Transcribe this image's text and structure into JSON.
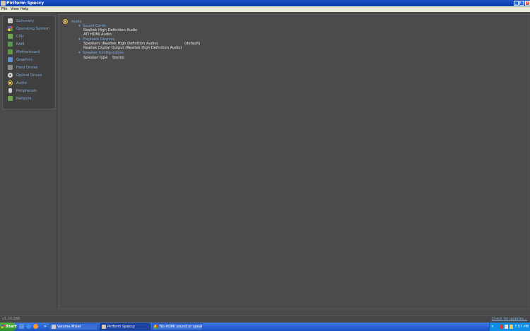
{
  "window": {
    "title": "Piriform Speccy",
    "controls": {
      "minimize": "_",
      "maximize": "□",
      "close": "×"
    }
  },
  "menu": [
    "File",
    "View",
    "Help"
  ],
  "sidebar": {
    "items": [
      {
        "label": "Summary",
        "icon": "summary-icon",
        "color": "#c9c9c9"
      },
      {
        "label": "Operating System",
        "icon": "windows-logo-icon",
        "color": "#e9a23b"
      },
      {
        "label": "CPU",
        "icon": "cpu-icon",
        "color": "#6aa84f"
      },
      {
        "label": "RAM",
        "icon": "ram-icon",
        "color": "#4f9a4f"
      },
      {
        "label": "Motherboard",
        "icon": "motherboard-icon",
        "color": "#5e9c3a"
      },
      {
        "label": "Graphics",
        "icon": "monitor-icon",
        "color": "#5b8fd0"
      },
      {
        "label": "Hard Drives",
        "icon": "hard-drive-icon",
        "color": "#8c8c8c"
      },
      {
        "label": "Optical Drives",
        "icon": "optical-drive-icon",
        "color": "#b8b8b8"
      },
      {
        "label": "Audio",
        "icon": "speaker-icon",
        "color": "#e3c15a"
      },
      {
        "label": "Peripherals",
        "icon": "mouse-icon",
        "color": "#d0d0d0"
      },
      {
        "label": "Network",
        "icon": "network-icon",
        "color": "#6ba34a"
      }
    ]
  },
  "main": {
    "section_title": "Audio",
    "groups": [
      {
        "title": "Sound Cards",
        "items": [
          {
            "name": "Realtek High Definition Audio",
            "value": ""
          },
          {
            "name": "ATI HDMI Audio",
            "value": ""
          }
        ]
      },
      {
        "title": "Playback Devices",
        "items": [
          {
            "name": "Speakers (Realtek High Definition Audio)",
            "value": "(default)"
          },
          {
            "name": "Realtek Digital Output (Realtek High Definition Audio)",
            "value": ""
          }
        ]
      },
      {
        "title": "Speaker Configuration",
        "items": [
          {
            "name": "Speaker type",
            "value": "Stereo"
          }
        ]
      }
    ]
  },
  "status": {
    "version": "v1.14.288",
    "check_updates": "Check for updates..."
  },
  "taskbar": {
    "start_label": "Start",
    "quick_launch": [
      "show-desktop-icon",
      "internet-explorer-icon",
      "media-player-icon"
    ],
    "buttons": [
      {
        "label": "Volume Mixer",
        "icon": "volume-mixer-icon",
        "active": false
      },
      {
        "label": "Piriform Speccy",
        "icon": "speccy-icon",
        "active": true
      },
      {
        "label": "No HDMI sound or speak...",
        "icon": "chrome-icon",
        "active": false
      }
    ],
    "clock": "7:57 PM"
  }
}
